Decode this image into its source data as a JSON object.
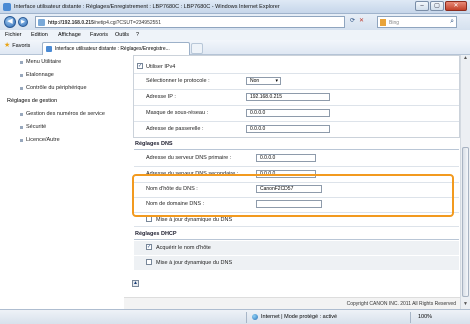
{
  "window": {
    "title": "Interface utilisateur distante : Réglages/Enregistrement : LBP7680C : LBP7680C - Windows Internet Explorer",
    "minimize": "–",
    "maximize": "▢",
    "close": "✕"
  },
  "address_bar": {
    "url_host": "http://192.168.0.215",
    "url_path": "/netip4.cgi?CSUT=234952551",
    "search_placeholder": "Bing",
    "back": "◀",
    "forward": "▶"
  },
  "menu": {
    "items": [
      "Fichier",
      "Edition",
      "Affichage",
      "Favoris",
      "Outils",
      "?"
    ]
  },
  "favorites_bar": {
    "favorites_label": "Favoris",
    "tab_label": "Interface utilisateur distante : Réglages/Enregistre..."
  },
  "left_nav": {
    "items": [
      {
        "label": "Menu Utilitaire"
      },
      {
        "label": "Etalonnage"
      },
      {
        "label": "Contrôle du périphérique"
      }
    ],
    "heading": "Réglages de gestion",
    "sub_items": [
      {
        "label": "Gestion des numéros de service"
      },
      {
        "label": "Sécurité"
      },
      {
        "label": "Licence/Autre"
      }
    ]
  },
  "ipv4": {
    "use_label": "Utiliser IPv4",
    "use_checked": true,
    "protocol_label": "Sélectionner le protocole :",
    "protocol_value": "Non",
    "ip_label": "Adresse IP :",
    "ip_value": "192.168.0.215",
    "subnet_label": "Masque de sous-réseau :",
    "subnet_value": "0.0.0.0",
    "gateway_label": "Adresse de passerelle :",
    "gateway_value": "0.0.0.0"
  },
  "dns": {
    "title": "Réglages DNS",
    "primary_label": "Adresse du serveur DNS primaire :",
    "primary_value": "0.0.0.0",
    "secondary_label": "Adresse du serveur DNS secondaire :",
    "secondary_value": "0.0.0.0",
    "hostname_label": "Nom d'hôte du DNS :",
    "hostname_value": "CanonF2CD57",
    "domain_label": "Nom de domaine DNS :",
    "domain_value": "",
    "dyn_update_label": "Mise à jour dynamique du DNS",
    "dyn_update_checked": false
  },
  "dhcp": {
    "title": "Réglages DHCP",
    "acquire_label": "Acquérir le nom d'hôte",
    "acquire_checked": true,
    "dyn_update_label": "Mise à jour dynamique du DNS",
    "dyn_update_checked": false
  },
  "footer": {
    "copyright": "Copyright CANON INC. 2011 All Rights Reserved"
  },
  "status_bar": {
    "zone": "Internet | Mode protégé : activé",
    "zoom": "100%"
  },
  "colors": {
    "highlight": "#f29a1f",
    "chrome": "#dfe9f5"
  }
}
